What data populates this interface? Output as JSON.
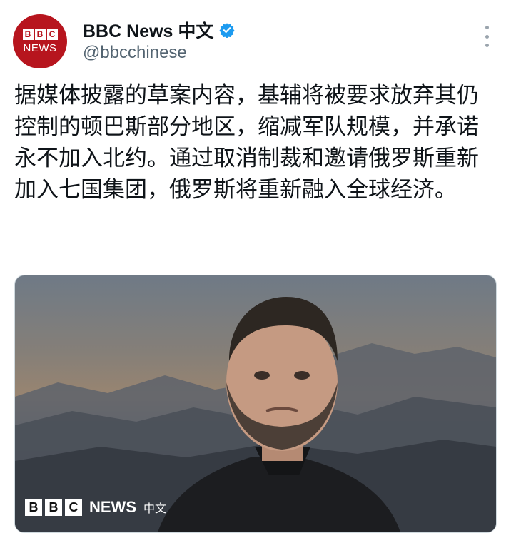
{
  "profile": {
    "avatar_blocks": [
      "B",
      "B",
      "C"
    ],
    "avatar_word": "NEWS",
    "display_name": "BBC News 中文",
    "handle": "@bbcchinese",
    "verified": true
  },
  "tweet": {
    "text": "据媒体披露的草案内容，基辅将被要求放弃其仍控制的顿巴斯部分地区，缩减军队规模，并承诺永不加入北约。通过取消制裁和邀请俄罗斯重新加入七国集团，俄罗斯将重新融入全球经济。"
  },
  "media": {
    "logo_blocks": [
      "B",
      "B",
      "C"
    ],
    "logo_news": "NEWS",
    "logo_zh": "中文"
  },
  "icons": {
    "more": "more-vertical-icon",
    "verified": "verified-badge-icon"
  },
  "colors": {
    "bbc_red": "#b7151e",
    "verified_blue": "#1d9bf0",
    "handle_gray": "#536471"
  }
}
